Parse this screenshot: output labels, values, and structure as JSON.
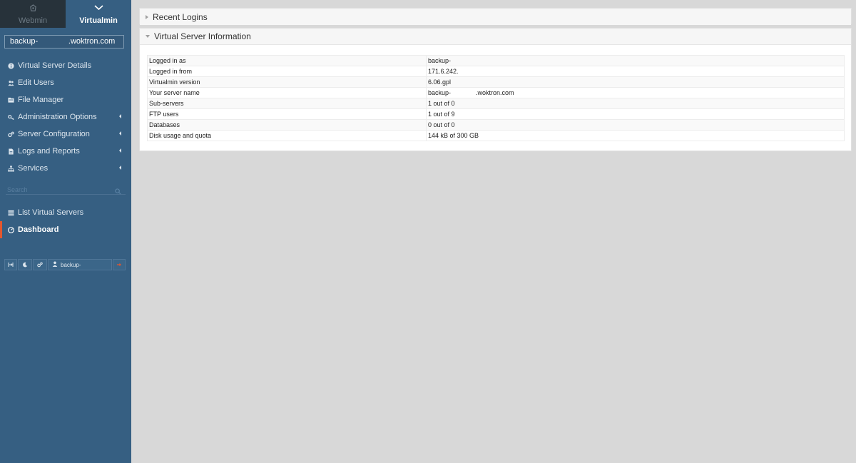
{
  "sidebar": {
    "tabs": [
      {
        "label": "Webmin",
        "icon": "webmin-icon"
      },
      {
        "label": "Virtualmin",
        "icon": "chevron-down-icon"
      }
    ],
    "domain_selector": "backup-              .woktron.com",
    "menu": [
      {
        "label": "Virtual Server Details",
        "icon": "info-icon",
        "has_submenu": false
      },
      {
        "label": "Edit Users",
        "icon": "users-icon",
        "has_submenu": false
      },
      {
        "label": "File Manager",
        "icon": "folder-icon",
        "has_submenu": false
      },
      {
        "label": "Administration Options",
        "icon": "key-icon",
        "has_submenu": true
      },
      {
        "label": "Server Configuration",
        "icon": "cogs-icon",
        "has_submenu": true
      },
      {
        "label": "Logs and Reports",
        "icon": "file-icon",
        "has_submenu": true
      },
      {
        "label": "Services",
        "icon": "sitemap-icon",
        "has_submenu": true
      }
    ],
    "search": {
      "placeholder": "Search"
    },
    "menu2": [
      {
        "label": "List Virtual Servers",
        "icon": "list-icon"
      },
      {
        "label": "Dashboard",
        "icon": "dashboard-icon",
        "active": true
      }
    ],
    "bottom": {
      "user": "backup-"
    }
  },
  "panels": {
    "recent_logins": {
      "title": "Recent Logins",
      "state": "collapsed"
    },
    "server_info": {
      "title": "Virtual Server Information",
      "state": "expanded",
      "rows": [
        {
          "label": "Logged in as",
          "value": "backup-"
        },
        {
          "label": "Logged in from",
          "value": "171.6.242."
        },
        {
          "label": "Virtualmin version",
          "value": "6.06.gpl"
        },
        {
          "label": "Your server name",
          "value": "backup-              .woktron.com"
        },
        {
          "label": "Sub-servers",
          "value": "1 out of 0"
        },
        {
          "label": "FTP users",
          "value": "1 out of 9"
        },
        {
          "label": "Databases",
          "value": "0 out of 0"
        },
        {
          "label": "Disk usage and quota",
          "value": "144 kB of 300 GB"
        }
      ]
    }
  },
  "colors": {
    "sidebar_bg": "#365f82",
    "active_marker": "#e4572e",
    "page_bg": "#d8d8d8"
  }
}
